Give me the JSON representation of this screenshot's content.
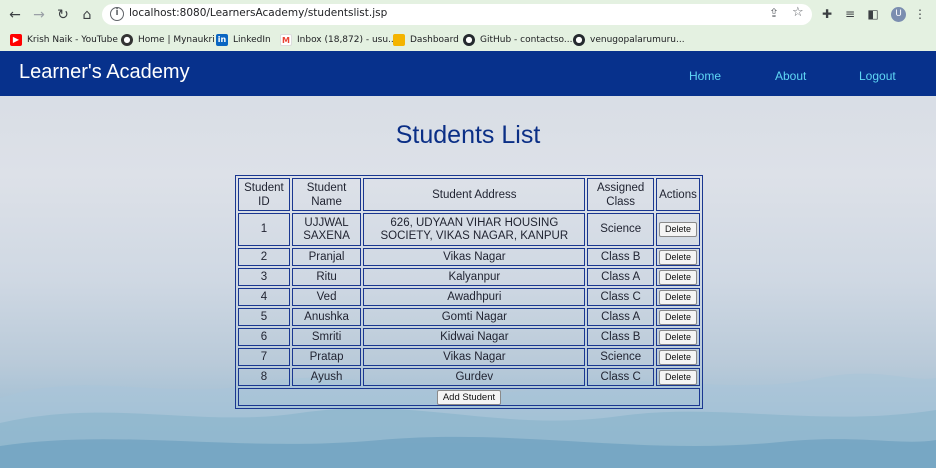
{
  "browser": {
    "url": "localhost:8080/LearnersAcademy/studentslist.jsp",
    "avatar_letter": "U",
    "bookmarks": [
      {
        "label": "Krish Naik - YouTube",
        "icon": "youtube-icon",
        "color": "#ff0000"
      },
      {
        "label": "Home | Mynaukri",
        "icon": "globe-icon",
        "color": "#333333"
      },
      {
        "label": "LinkedIn",
        "icon": "linkedin-icon",
        "color": "#0a66c2"
      },
      {
        "label": "Inbox (18,872) - usu...",
        "icon": "gmail-icon",
        "color": "#ea4335"
      },
      {
        "label": "Dashboard",
        "icon": "bookmark-icon",
        "color": "#f4b400"
      },
      {
        "label": "GitHub - contactso...",
        "icon": "github-icon",
        "color": "#24292e"
      },
      {
        "label": "venugopalarumuru...",
        "icon": "github-icon",
        "color": "#24292e"
      }
    ]
  },
  "header": {
    "brand": "Learner's Academy",
    "nav": [
      "Home",
      "About",
      "Logout"
    ]
  },
  "page_title": "Students List",
  "table": {
    "columns": [
      "Student ID",
      "Student Name",
      "Student Address",
      "Assigned Class",
      "Actions"
    ],
    "rows": [
      {
        "id": "1",
        "name": "UJJWAL SAXENA",
        "address": "626, UDYAAN VIHAR HOUSING SOCIETY, VIKAS NAGAR, KANPUR",
        "class": "Science"
      },
      {
        "id": "2",
        "name": "Pranjal",
        "address": "Vikas Nagar",
        "class": "Class B"
      },
      {
        "id": "3",
        "name": "Ritu",
        "address": "Kalyanpur",
        "class": "Class A"
      },
      {
        "id": "4",
        "name": "Ved",
        "address": "Awadhpuri",
        "class": "Class C"
      },
      {
        "id": "5",
        "name": "Anushka",
        "address": "Gomti Nagar",
        "class": "Class A"
      },
      {
        "id": "6",
        "name": "Smriti",
        "address": "Kidwai Nagar",
        "class": "Class B"
      },
      {
        "id": "7",
        "name": "Pratap",
        "address": "Vikas Nagar",
        "class": "Science"
      },
      {
        "id": "8",
        "name": "Ayush",
        "address": "Gurdev",
        "class": "Class C"
      }
    ],
    "delete_label": "Delete",
    "add_label": "Add Student"
  },
  "colors": {
    "header_bg": "#07318c",
    "nav_link": "#5fd7f5",
    "title": "#0b2f86",
    "table_border": "#1a3790"
  }
}
